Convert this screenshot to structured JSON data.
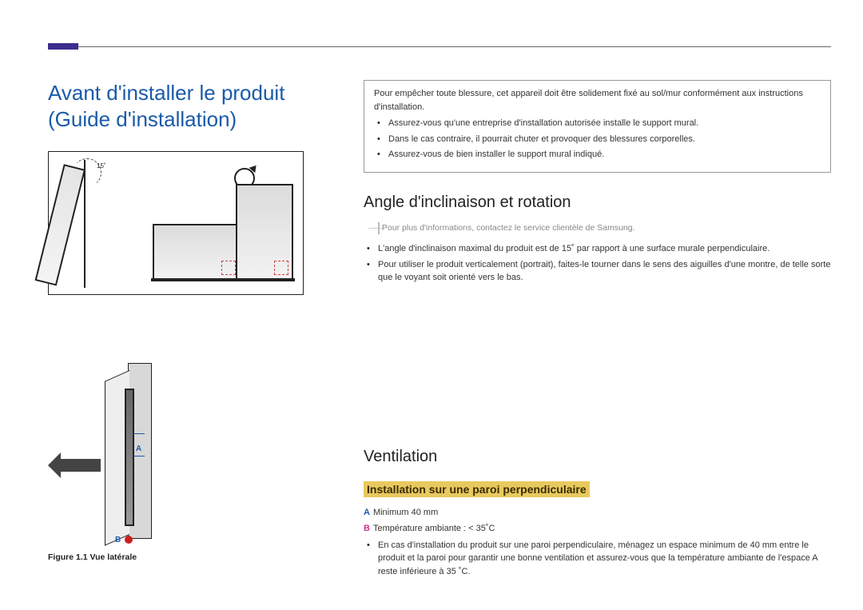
{
  "header": {},
  "main": {
    "title": "Avant d'installer le produit (Guide d'installation)",
    "diagram_top": {
      "angle_label": "15˚"
    },
    "figure_caption": "Figure 1.1 Vue latérale"
  },
  "right": {
    "warning_intro": "Pour empêcher toute blessure, cet appareil doit être solidement fixé au sol/mur conformément aux instructions d'installation.",
    "warning_bullets": [
      "Assurez-vous qu'une entreprise d'installation autorisée installe le support mural.",
      "Dans le cas contraire, il pourrait chuter et provoquer des blessures corporelles.",
      "Assurez-vous de bien installer le support mural indiqué."
    ],
    "angle_section": {
      "heading": "Angle d'inclinaison et rotation",
      "note": "Pour plus d'informations, contactez le service clientèle de Samsung.",
      "bullets": [
        "L'angle d'inclinaison maximal du produit est de 15˚ par rapport à une surface murale perpendiculaire.",
        "Pour utiliser le produit verticalement (portrait), faites-le tourner dans le sens des aiguilles d'une montre, de telle sorte que le voyant soit orienté vers le bas."
      ]
    },
    "ventilation": {
      "heading": "Ventilation",
      "subheading": "Installation sur une paroi perpendiculaire",
      "spec_a_label": "A",
      "spec_a_text": "Minimum 40 mm",
      "spec_b_label": "B",
      "spec_b_text": "Température ambiante : < 35˚C",
      "bullets": [
        "En cas d'installation du produit sur une paroi perpendiculaire, ménagez un espace minimum de 40 mm entre le produit et la paroi pour garantir une bonne ventilation et assurez-vous que la température ambiante de l'espace A reste inférieure à 35 ˚C."
      ]
    }
  }
}
